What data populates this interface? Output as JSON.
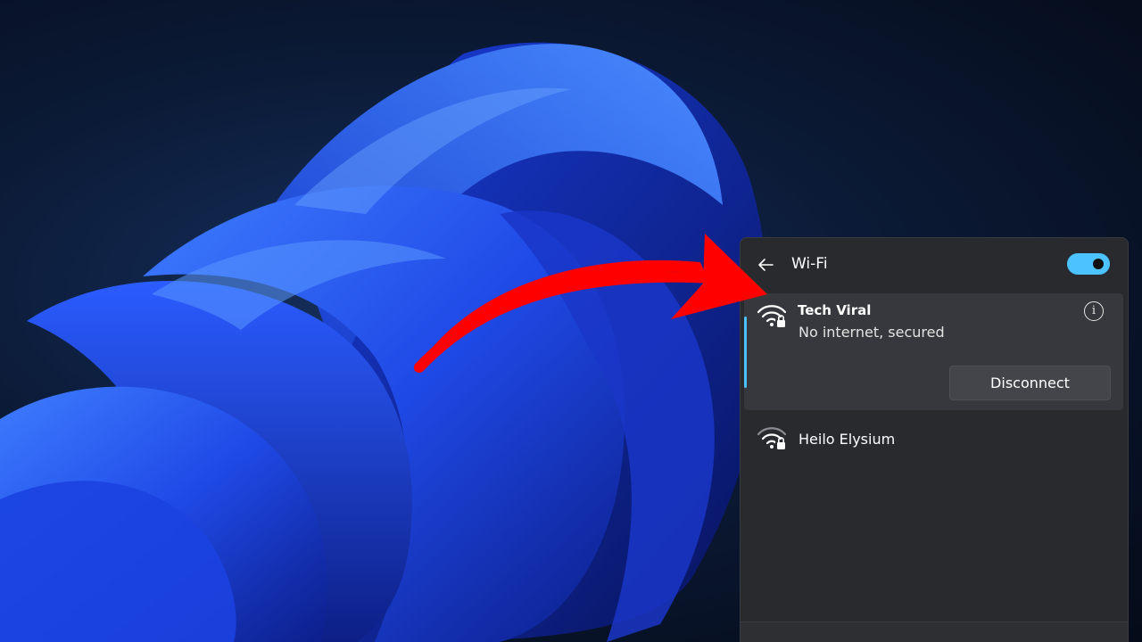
{
  "wifi_panel": {
    "title": "Wi-Fi",
    "toggle_on": true,
    "accent_color": "#4cc2ff",
    "back_icon": "arrow-left-icon",
    "networks": [
      {
        "name": "Tech Viral",
        "status": "No internet, secured",
        "icon": "wifi-secured-icon",
        "connected": true,
        "action_label": "Disconnect",
        "info_icon": "info-icon"
      },
      {
        "name": "Heilo Elysium",
        "icon": "wifi-secured-icon",
        "connected": false
      }
    ]
  },
  "annotation": {
    "arrow_color": "#ff0000",
    "icon": "red-curved-arrow-icon"
  }
}
